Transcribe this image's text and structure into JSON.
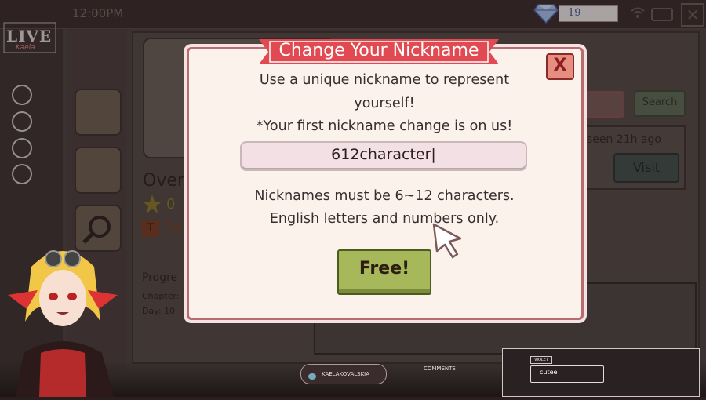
{
  "status_bar": {
    "time": "12:00PM",
    "gems": "19"
  },
  "background": {
    "overview_label": "Over",
    "stars_partial": "0",
    "points_partial": "34",
    "progress_label": "Progre",
    "chapter_label": "Chapter:",
    "day_label": "Day: 10",
    "search_label": "Search",
    "last_seen": "t seen 21h ago",
    "visit_label": "Visit"
  },
  "overlay": {
    "live_logo": "LIVE",
    "live_sub": "Kaela",
    "twitter_handle": "KAELAKOVALSKIA",
    "comments_label": "COMMENTS",
    "chat_user": "VIOLET",
    "chat_message": "cutee"
  },
  "modal": {
    "title": "Change Your Nickname",
    "line1": "Use a unique nickname to represent",
    "line2": "yourself!",
    "line3": "*Your first nickname change is on us!",
    "input_value": "612character|",
    "rule1": "Nicknames must be 6~12 characters.",
    "rule2": "English letters and numbers only.",
    "free_button": "Free!",
    "close_glyph": "X"
  },
  "colors": {
    "accent_red": "#e0464e",
    "button_green": "#a6b85a",
    "modal_bg": "#fbf2ec"
  }
}
